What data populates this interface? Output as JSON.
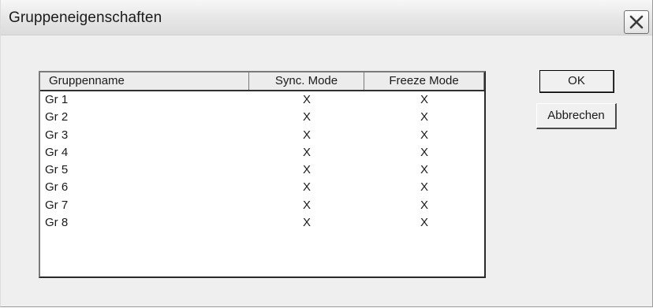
{
  "window": {
    "title": "Gruppeneigenschaften",
    "close_icon": "close-icon"
  },
  "list": {
    "columns": [
      "Gruppenname",
      "Sync. Mode",
      "Freeze Mode"
    ],
    "rows": [
      {
        "name": "Gr 1",
        "sync": "X",
        "freeze": "X"
      },
      {
        "name": "Gr 2",
        "sync": "X",
        "freeze": "X"
      },
      {
        "name": "Gr 3",
        "sync": "X",
        "freeze": "X"
      },
      {
        "name": "Gr 4",
        "sync": "X",
        "freeze": "X"
      },
      {
        "name": "Gr 5",
        "sync": "X",
        "freeze": "X"
      },
      {
        "name": "Gr 6",
        "sync": "X",
        "freeze": "X"
      },
      {
        "name": "Gr 7",
        "sync": "X",
        "freeze": "X"
      },
      {
        "name": "Gr 8",
        "sync": "X",
        "freeze": "X"
      }
    ]
  },
  "buttons": {
    "ok_label": "OK",
    "cancel_label": "Abbrechen"
  }
}
